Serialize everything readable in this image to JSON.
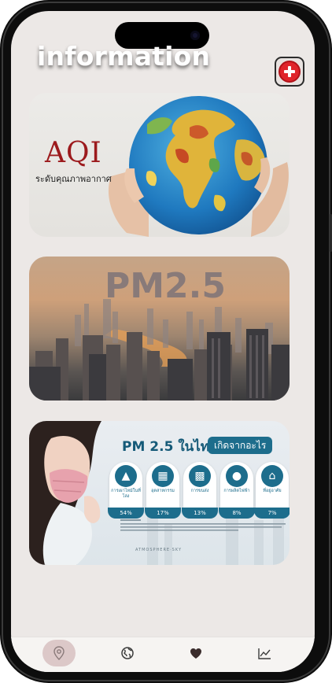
{
  "header": {
    "title": "information"
  },
  "cards": {
    "aqi": {
      "title": "AQI",
      "subtitle": "ระดับคุณภาพอากาศ"
    },
    "pm25": {
      "title": "PM2.5"
    },
    "infographic": {
      "title": "PM 2.5 ในไทย",
      "pill": "เกิดจากอะไร",
      "sources": [
        {
          "icon": "fire-icon",
          "label": "การเผาไหม้ในที่โล่ง",
          "pct": "54%"
        },
        {
          "icon": "factory-icon",
          "label": "อุตสาหกรรม",
          "pct": "17%"
        },
        {
          "icon": "truck-icon",
          "label": "การขนส่ง",
          "pct": "13%"
        },
        {
          "icon": "bulb-icon",
          "label": "การผลิตไฟฟ้า",
          "pct": "8%"
        },
        {
          "icon": "house-icon",
          "label": "ที่อยู่อาศัย",
          "pct": "7%"
        }
      ],
      "brand": "ATMOSPHERE·SKY"
    }
  },
  "tabs": [
    {
      "icon": "location-pin-icon",
      "active": true
    },
    {
      "icon": "globe-icon",
      "active": false
    },
    {
      "icon": "heart-icon",
      "active": false
    },
    {
      "icon": "trend-chart-icon",
      "active": false
    }
  ],
  "colors": {
    "screen_bg": "#ece8e6",
    "accent_red": "#e0242b",
    "aqi_red": "#9c1a1d",
    "info_teal": "#1d6d8c",
    "tab_active_bg": "#dcc8c8"
  }
}
